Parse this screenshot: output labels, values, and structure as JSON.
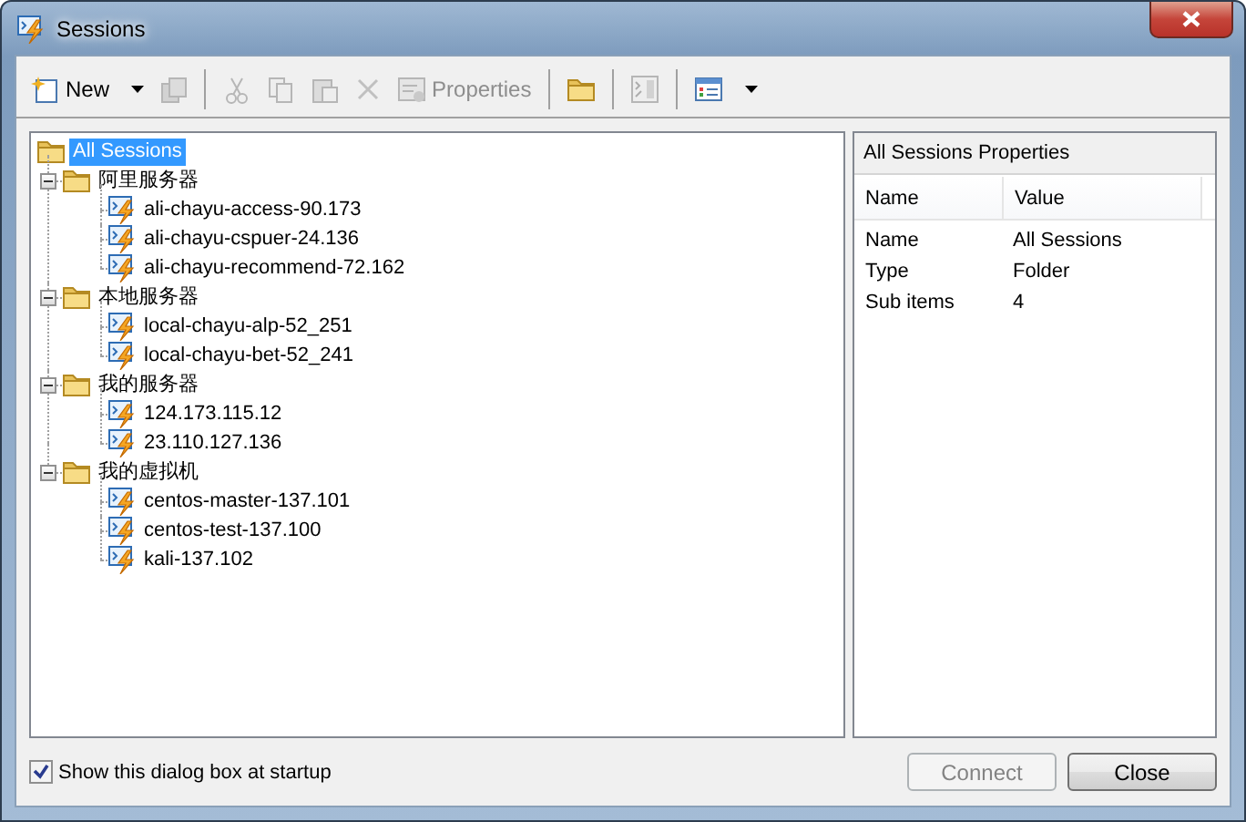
{
  "window": {
    "title": "Sessions"
  },
  "toolbar": [
    {
      "kind": "new",
      "label": "New",
      "disabled": false,
      "dropdown": true
    },
    {
      "kind": "save",
      "disabled": true
    },
    {
      "kind": "separator"
    },
    {
      "kind": "cut",
      "disabled": true
    },
    {
      "kind": "copy",
      "disabled": true
    },
    {
      "kind": "paste",
      "disabled": true
    },
    {
      "kind": "delete",
      "disabled": true
    },
    {
      "kind": "properties",
      "label": "Properties",
      "disabled": true
    },
    {
      "kind": "separator"
    },
    {
      "kind": "folder",
      "disabled": false
    },
    {
      "kind": "separator"
    },
    {
      "kind": "script",
      "disabled": true
    },
    {
      "kind": "separator"
    },
    {
      "kind": "view",
      "disabled": false,
      "dropdown": true
    }
  ],
  "tree": {
    "label": "All Sessions",
    "kind": "folder",
    "selected": true,
    "expanded": true,
    "children": [
      {
        "label": "阿里服务器",
        "kind": "folder",
        "selected": false,
        "expanded": true,
        "children": [
          {
            "label": "ali-chayu-access-90.173",
            "kind": "session",
            "selected": false
          },
          {
            "label": "ali-chayu-cspuer-24.136",
            "kind": "session",
            "selected": false
          },
          {
            "label": "ali-chayu-recommend-72.162",
            "kind": "session",
            "selected": false
          }
        ]
      },
      {
        "label": "本地服务器",
        "kind": "folder",
        "selected": false,
        "expanded": true,
        "children": [
          {
            "label": "local-chayu-alp-52_251",
            "kind": "session",
            "selected": false
          },
          {
            "label": "local-chayu-bet-52_241",
            "kind": "session",
            "selected": false
          }
        ]
      },
      {
        "label": "我的服务器",
        "kind": "folder",
        "selected": false,
        "expanded": true,
        "children": [
          {
            "label": "124.173.115.12",
            "kind": "session",
            "selected": false
          },
          {
            "label": "23.110.127.136",
            "kind": "session",
            "selected": false
          }
        ]
      },
      {
        "label": "我的虚拟机",
        "kind": "folder",
        "selected": false,
        "expanded": true,
        "children": [
          {
            "label": "centos-master-137.101",
            "kind": "session",
            "selected": false
          },
          {
            "label": "centos-test-137.100",
            "kind": "session",
            "selected": false
          },
          {
            "label": "kali-137.102",
            "kind": "session",
            "selected": false
          }
        ]
      }
    ]
  },
  "properties": {
    "title": "All Sessions Properties",
    "columns": [
      "Name",
      "Value"
    ],
    "rows": [
      [
        "Name",
        "All Sessions"
      ],
      [
        "Type",
        "Folder"
      ],
      [
        "Sub items",
        "4"
      ]
    ]
  },
  "startup_checkbox": {
    "label": "Show this dialog box at startup",
    "checked": true
  },
  "buttons": [
    {
      "label": "Connect",
      "disabled": true
    },
    {
      "label": "Close",
      "disabled": false
    }
  ]
}
